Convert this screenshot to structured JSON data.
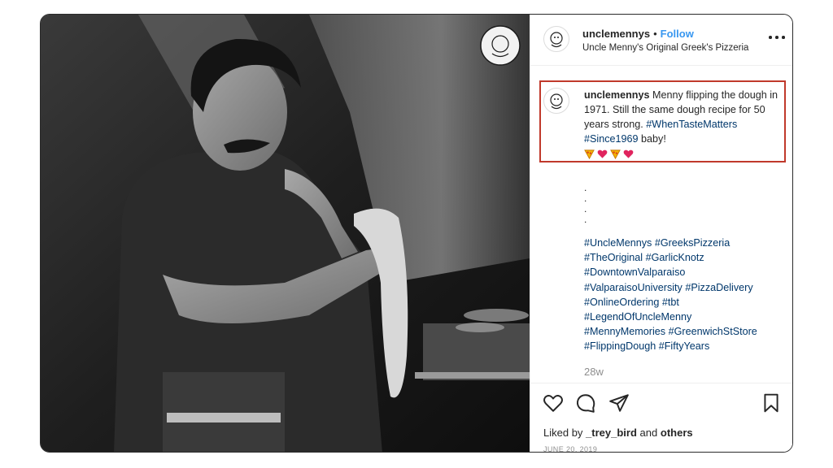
{
  "post": {
    "username": "unclemennys",
    "separator": "•",
    "follow_label": "Follow",
    "location": "Uncle Menny's Original Greek's Pizzeria",
    "caption_text": "Menny flipping the dough in 1971. Still the same dough recipe for 50 years strong.",
    "caption_tags": [
      "#WhenTasteMatters",
      "#Since1969"
    ],
    "caption_tail": "baby!",
    "caption_emojis": [
      "pizza-icon",
      "heart-icon",
      "pizza-icon",
      "heart-icon"
    ],
    "dots": [
      ".",
      ".",
      ".",
      "."
    ],
    "hashtags": [
      "#UncleMennys",
      "#GreeksPizzeria",
      "#TheOriginal",
      "#GarlicKnotz",
      "#DowntownValparaiso",
      "#ValparaisoUniversity",
      "#PizzaDelivery",
      "#OnlineOrdering",
      "#tbt",
      "#LegendOfUncleMenny",
      "#MennyMemories",
      "#GreenwichStStore",
      "#FlippingDough",
      "#FiftyYears"
    ],
    "time_ago": "28w",
    "liked_by_prefix": "Liked by",
    "liked_by_user": "_trey_bird",
    "liked_by_and": "and",
    "liked_by_others": "others",
    "date": "JUNE 20, 2019"
  },
  "colors": {
    "follow": "#3897f0",
    "hashtag": "#00376b",
    "highlight_box": "#c0392b",
    "meta_grey": "#8e8e8e"
  }
}
